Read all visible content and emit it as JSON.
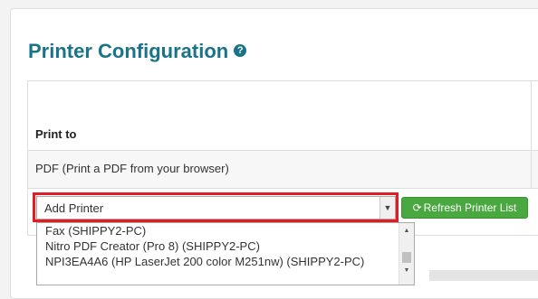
{
  "page": {
    "title": "Printer Configuration",
    "help_icon": "question-circle-icon"
  },
  "table": {
    "header": "Print to",
    "pdf_option": "PDF (Print a PDF from your browser)"
  },
  "printer_select": {
    "selected": "Add Printer",
    "highlight_color": "#e31b23",
    "options": [
      "Fax (SHIPPY2-PC)",
      "Nitro PDF Creator (Pro 8) (SHIPPY2-PC)",
      "NPI3EA4A6 (HP LaserJet 200 color M251nw) (SHIPPY2-PC)"
    ]
  },
  "refresh_button": {
    "label": "Refresh Printer List",
    "icon": "refresh-icon",
    "color": "#4aa840"
  },
  "colors": {
    "title": "#1a7488"
  }
}
